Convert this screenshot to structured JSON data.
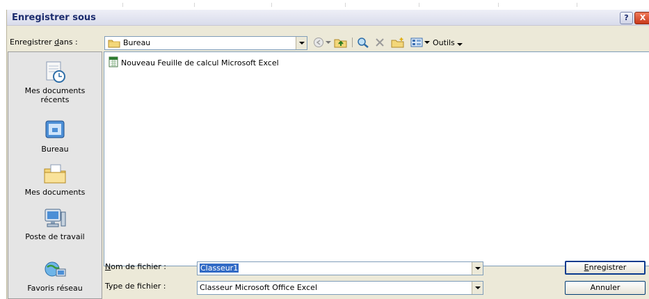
{
  "dialog": {
    "title": "Enregistrer sous",
    "help_glyph": "?",
    "close_glyph": "X"
  },
  "location": {
    "label_prefix": "Enregistrer ",
    "label_accel": "d",
    "label_suffix": "ans :",
    "value": "Bureau"
  },
  "toolbar": {
    "tools_label": "Outils",
    "icons": [
      "back-icon",
      "up-folder-icon",
      "search-web-icon",
      "delete-icon",
      "new-folder-icon",
      "views-icon"
    ]
  },
  "places": [
    {
      "label": "Mes documents récents",
      "icon": "recent-documents-icon"
    },
    {
      "label": "Bureau",
      "icon": "desktop-icon"
    },
    {
      "label": "Mes documents",
      "icon": "my-documents-icon"
    },
    {
      "label": "Poste de travail",
      "icon": "my-computer-icon"
    },
    {
      "label": "Favoris réseau",
      "icon": "network-places-icon"
    }
  ],
  "files": [
    {
      "name": "Nouveau Feuille de calcul Microsoft Excel",
      "icon": "excel-file-icon"
    }
  ],
  "filename": {
    "label_accel": "N",
    "label_rest": "om de fichier :",
    "value": "Classeur1"
  },
  "filetype": {
    "label": "Type de fichier :",
    "value": "Classeur Microsoft Office Excel"
  },
  "buttons": {
    "save_accel": "E",
    "save_rest": "nregistrer",
    "cancel": "Annuler"
  },
  "colors": {
    "titlebar_text": "#1c2c6e",
    "dialog_bg": "#ece9d8",
    "close_button": "#c8381a",
    "combo_border": "#7f9db9"
  }
}
